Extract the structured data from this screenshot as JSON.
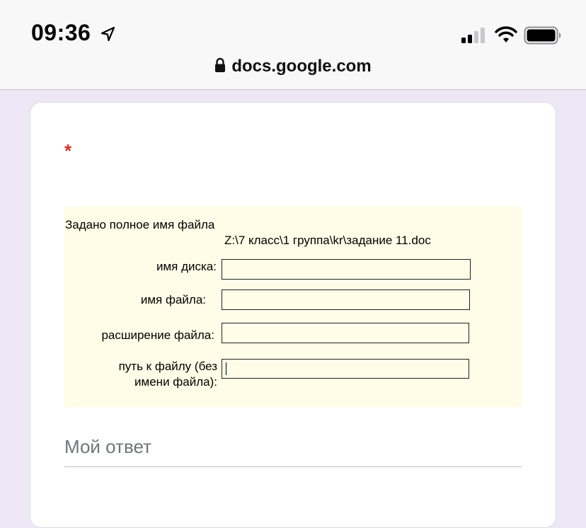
{
  "status_bar": {
    "time": "09:36"
  },
  "browser": {
    "url": "docs.google.com"
  },
  "question": {
    "required_mark": "*",
    "task_title": "Задано полное имя файла",
    "task_path": "Z:\\7 класс\\1 группа\\kr\\задание 11.doc",
    "fields": [
      {
        "label": "имя диска:",
        "value": ""
      },
      {
        "label": "имя файла:",
        "value": ""
      },
      {
        "label": "расширение файла:",
        "value": ""
      },
      {
        "label_line1": "путь к файлу (без",
        "label_line2": "имени файла):",
        "value": ""
      }
    ]
  },
  "answer": {
    "placeholder": "Мой ответ"
  },
  "colors": {
    "page_background": "#ede7f6",
    "task_background": "#fffde7",
    "required_red": "#d93025"
  },
  "icons": [
    "location-arrow-icon",
    "cellular-signal-icon",
    "wifi-icon",
    "battery-icon",
    "lock-icon"
  ]
}
